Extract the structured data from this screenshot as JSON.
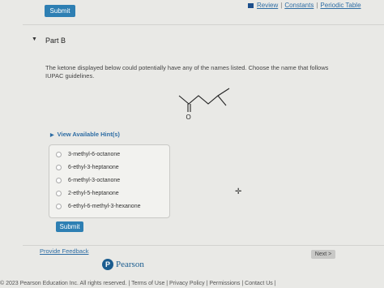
{
  "toolbar": {
    "submit_label": "Submit"
  },
  "header_links": [
    "Review",
    "Constants",
    "Periodic Table"
  ],
  "part": {
    "title": "Part B"
  },
  "question": {
    "text": "The ketone displayed below could potentially have any of the names listed. Choose the name that follows IUPAC guidelines."
  },
  "molecule": {
    "oxygen_label": "O",
    "icon": "ketone-skeletal-structure"
  },
  "hints": {
    "label": "View Available Hint(s)"
  },
  "choices": [
    "3-methyl-6-octanone",
    "6-ethyl-3-heptanone",
    "6-methyl-3-octanone",
    "2-ethyl-5-heptanone",
    "6-ethyl-6-methyl-3-hexanone"
  ],
  "answer": {
    "submit_label": "Submit"
  },
  "feedback": {
    "label": "Provide Feedback"
  },
  "navigation": {
    "next_label": "Next >"
  },
  "brand": {
    "logo_letter": "P",
    "name": "Pearson"
  },
  "footer": {
    "text": "© 2023 Pearson Education Inc. All rights reserved. | Terms of Use | Privacy Policy | Permissions | Contact Us |"
  },
  "colors": {
    "accent": "#2e7fb3",
    "link": "#2e6da4",
    "brand": "#1a5c8f"
  }
}
